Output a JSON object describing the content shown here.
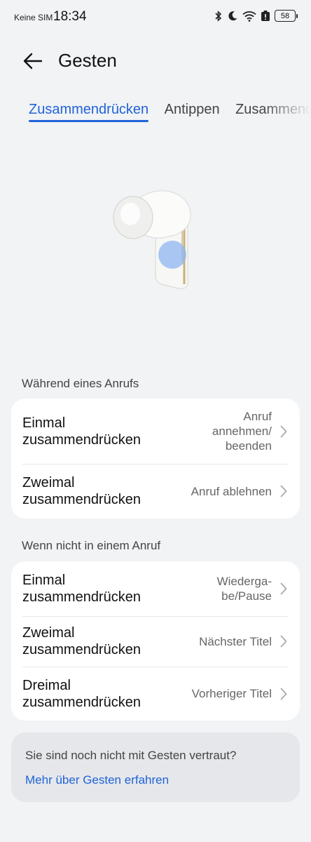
{
  "status_bar": {
    "carrier": "Keine SIM",
    "time": "18:34",
    "battery": "58",
    "icons": [
      "bluetooth-icon",
      "moon-icon",
      "wifi-icon",
      "alert-icon",
      "battery-icon"
    ]
  },
  "header": {
    "title": "Gesten",
    "back_icon": "arrow-left-icon"
  },
  "tabs": [
    {
      "label": "Zusammendrücken",
      "active": true
    },
    {
      "label": "Antippen",
      "active": false
    },
    {
      "label": "Zusammendrücken und halten",
      "active": false
    }
  ],
  "sections": {
    "during_call": {
      "label": "Während eines Anrufs",
      "rows": [
        {
          "title": "Einmal zusammendrücken",
          "value": "Anruf annehmen/ beenden"
        },
        {
          "title": "Zweimal zusammendrücken",
          "value": "Anruf ablehnen"
        }
      ]
    },
    "not_in_call": {
      "label": "Wenn nicht in einem Anruf",
      "rows": [
        {
          "title": "Einmal zusammendrücken",
          "value": "Wiederga-be/Pause"
        },
        {
          "title": "Zweimal zusammendrücken",
          "value": "Nächster Titel"
        },
        {
          "title": "Dreimal zusammendrücken",
          "value": "Vorheriger Titel"
        }
      ]
    }
  },
  "info": {
    "text": "Sie sind noch nicht mit Gesten vertraut?",
    "link": "Mehr über Gesten erfahren"
  },
  "colors": {
    "accent": "#2163d8",
    "background": "#f1f3f5",
    "card": "#ffffff"
  }
}
